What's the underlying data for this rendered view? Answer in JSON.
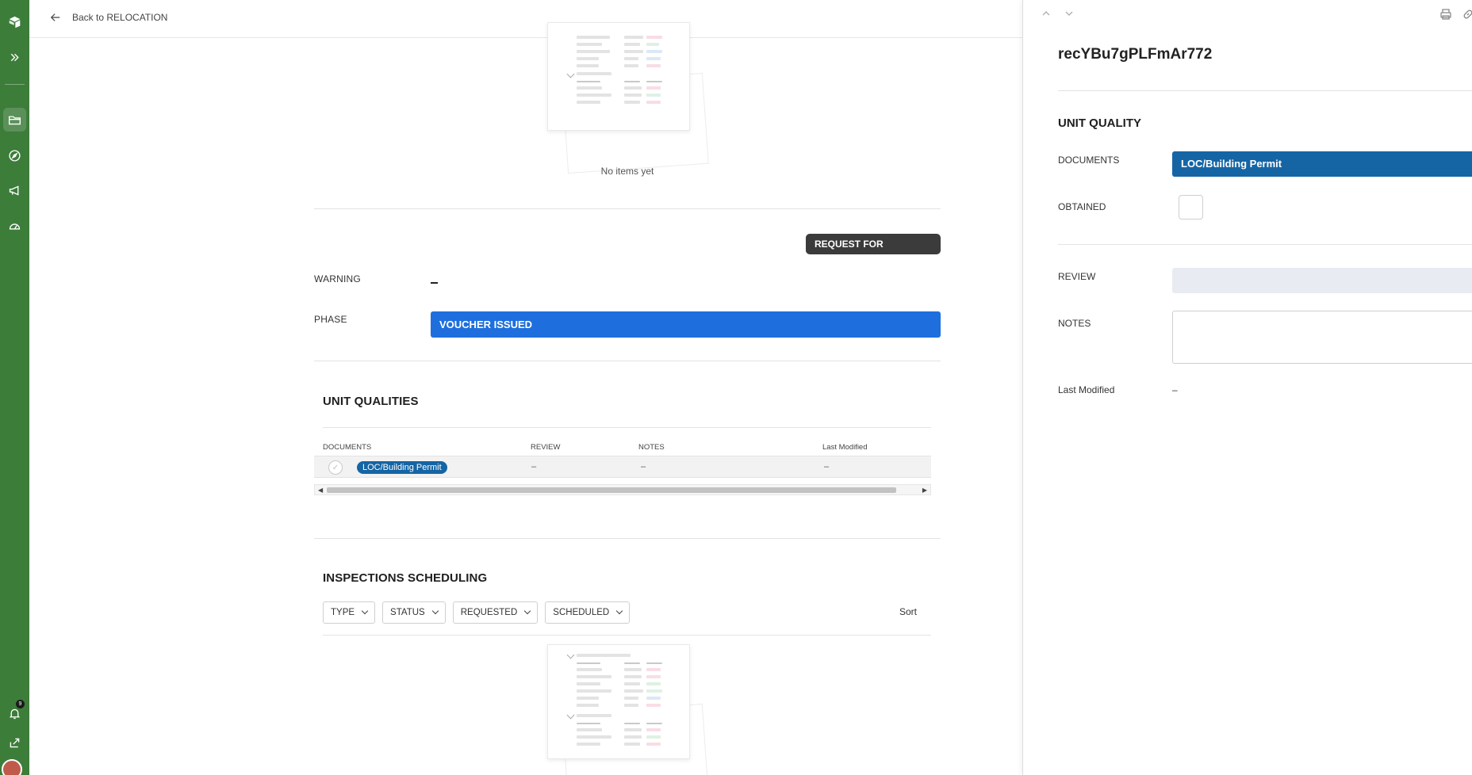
{
  "topbar": {
    "back_label": "Back to RELOCATION"
  },
  "rail": {
    "notification_count": "9"
  },
  "main": {
    "empty_text": "No items yet",
    "request_button": "REQUEST FOR INSPECTION",
    "warning_label": "WARNING",
    "phase_label": "PHASE",
    "phase_value": "VOUCHER ISSUED",
    "unit_qualities": {
      "title": "UNIT QUALITIES",
      "columns": [
        "DOCUMENTS",
        "REVIEW",
        "NOTES",
        "Last Modified"
      ],
      "rows": [
        {
          "document": "LOC/Building Permit",
          "review": "–",
          "notes": "–",
          "last_modified": "–"
        }
      ]
    },
    "inspections": {
      "title": "INSPECTIONS SCHEDULING",
      "filters": [
        "TYPE",
        "STATUS",
        "REQUESTED",
        "SCHEDULED"
      ],
      "sort_label": "Sort"
    }
  },
  "panel": {
    "record_id": "recYBu7gPLFmAr772",
    "section_title": "UNIT QUALITY",
    "documents_label": "DOCUMENTS",
    "documents_value": "LOC/Building Permit",
    "obtained_label": "OBTAINED",
    "obtained_checked": false,
    "review_label": "REVIEW",
    "notes_label": "NOTES",
    "last_modified_label": "Last Modified",
    "last_modified_value": "–"
  },
  "colors": {
    "rail": "#3c7d3a",
    "phase": "#1e6fdd",
    "document_pill": "#1565a5",
    "dark_button": "#3b3b3b"
  }
}
